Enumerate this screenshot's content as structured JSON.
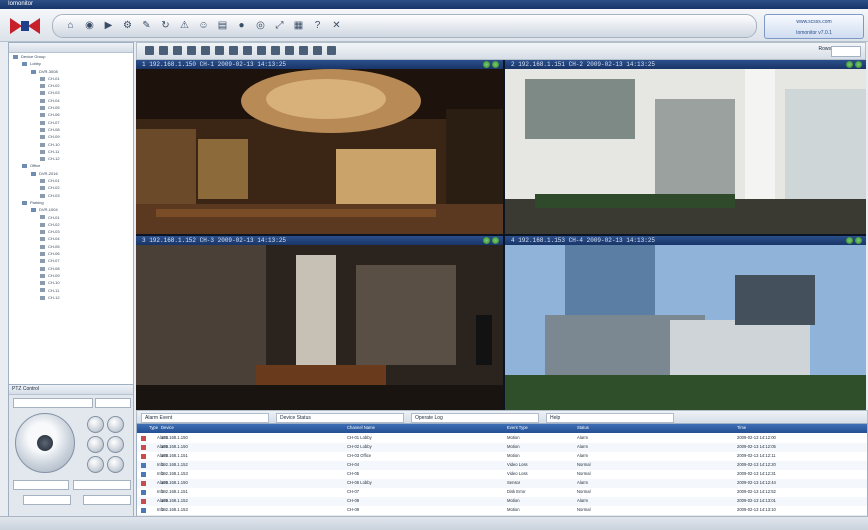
{
  "window": {
    "title": "Iomonitor"
  },
  "brand": {
    "line1": "www.scsss.com",
    "line2": "Iomonitor v7.0.1"
  },
  "toolbar": {
    "buttons": [
      "home",
      "live",
      "playback",
      "settings",
      "config",
      "sequence",
      "alarm",
      "user",
      "log",
      "record",
      "snapshot",
      "fullscreen",
      "layout",
      "help",
      "exit"
    ]
  },
  "video_toolbar": {
    "label": "Rows",
    "buttons": [
      "split-1",
      "split-4",
      "split-6",
      "split-8",
      "split-9",
      "split-10",
      "split-13",
      "split-16",
      "split-25",
      "split-36",
      "split-64",
      "custom-1",
      "custom-2",
      "save"
    ]
  },
  "tree": {
    "items": [
      {
        "label": "Device Group",
        "level": 0
      },
      {
        "label": "Lobby",
        "level": 1
      },
      {
        "label": "DVR-3008",
        "level": 2
      },
      {
        "label": "CH-01",
        "level": 3
      },
      {
        "label": "CH-02",
        "level": 3
      },
      {
        "label": "CH-03",
        "level": 3
      },
      {
        "label": "CH-04",
        "level": 3
      },
      {
        "label": "CH-05",
        "level": 3
      },
      {
        "label": "CH-06",
        "level": 3
      },
      {
        "label": "CH-07",
        "level": 3
      },
      {
        "label": "CH-08",
        "level": 3
      },
      {
        "label": "CH-09",
        "level": 3
      },
      {
        "label": "CH-10",
        "level": 3
      },
      {
        "label": "CH-11",
        "level": 3
      },
      {
        "label": "CH-12",
        "level": 3
      },
      {
        "label": "Office",
        "level": 1
      },
      {
        "label": "DVR-2016",
        "level": 2
      },
      {
        "label": "CH-01",
        "level": 3
      },
      {
        "label": "CH-02",
        "level": 3
      },
      {
        "label": "CH-03",
        "level": 3
      },
      {
        "label": "Parking",
        "level": 1
      },
      {
        "label": "DVR-1004",
        "level": 2
      },
      {
        "label": "CH-01",
        "level": 3
      },
      {
        "label": "CH-02",
        "level": 3
      },
      {
        "label": "CH-03",
        "level": 3
      },
      {
        "label": "CH-04",
        "level": 3
      },
      {
        "label": "CH-05",
        "level": 3
      },
      {
        "label": "CH-06",
        "level": 3
      },
      {
        "label": "CH-07",
        "level": 3
      },
      {
        "label": "CH-08",
        "level": 3
      },
      {
        "label": "CH-09",
        "level": 3
      },
      {
        "label": "CH-10",
        "level": 3
      },
      {
        "label": "CH-11",
        "level": 3
      },
      {
        "label": "CH-12",
        "level": 3
      }
    ]
  },
  "ptz": {
    "title": "PTZ Control",
    "preset_label": "Preset",
    "speed_label": "Speed"
  },
  "tiles": [
    {
      "caption": "1 192.168.1.150 CH-1  2009-02-13  14:13:25"
    },
    {
      "caption": "2 192.168.1.151 CH-2  2009-02-13  14:13:25"
    },
    {
      "caption": "3 192.168.1.152 CH-3  2009-02-13  14:13:25"
    },
    {
      "caption": "4 192.168.1.153 CH-4  2009-02-13  14:13:25"
    }
  ],
  "alarm_tabs": [
    "Alarm Event",
    "Device Status",
    "Operate Log",
    "Help"
  ],
  "grid": {
    "columns": [
      "Type",
      "Device",
      "Channel Name",
      "Event Type",
      "Status",
      "Time"
    ],
    "rows": [
      [
        "Alarm",
        "192.168.1.150",
        "CH-01 Lobby",
        "Motion",
        "Alarm",
        "2009-02-13 14:12:00"
      ],
      [
        "Alarm",
        "192.168.1.150",
        "CH-02 Lobby",
        "Motion",
        "Alarm",
        "2009-02-13 14:12:05"
      ],
      [
        "Alarm",
        "192.168.1.151",
        "CH-03 Office",
        "Motion",
        "Alarm",
        "2009-02-13 14:12:11"
      ],
      [
        "Info",
        "192.168.1.152",
        "CH-04",
        "Video Loss",
        "Normal",
        "2009-02-13 14:12:20"
      ],
      [
        "Info",
        "192.168.1.153",
        "CH-05",
        "Video Loss",
        "Normal",
        "2009-02-13 14:12:31"
      ],
      [
        "Alarm",
        "192.168.1.150",
        "CH-06 Lobby",
        "Sensor",
        "Alarm",
        "2009-02-13 14:12:44"
      ],
      [
        "Info",
        "192.168.1.151",
        "CH-07",
        "Disk Error",
        "Normal",
        "2009-02-13 14:12:52"
      ],
      [
        "Alarm",
        "192.168.1.152",
        "CH-08",
        "Motion",
        "Alarm",
        "2009-02-13 14:13:01"
      ],
      [
        "Info",
        "192.168.1.153",
        "CH-09",
        "Motion",
        "Normal",
        "2009-02-13 14:13:10"
      ]
    ]
  },
  "colors": {
    "accent": "#244f93",
    "tile_bar": "#1e3c70",
    "status_ok": "#3a9a34"
  }
}
